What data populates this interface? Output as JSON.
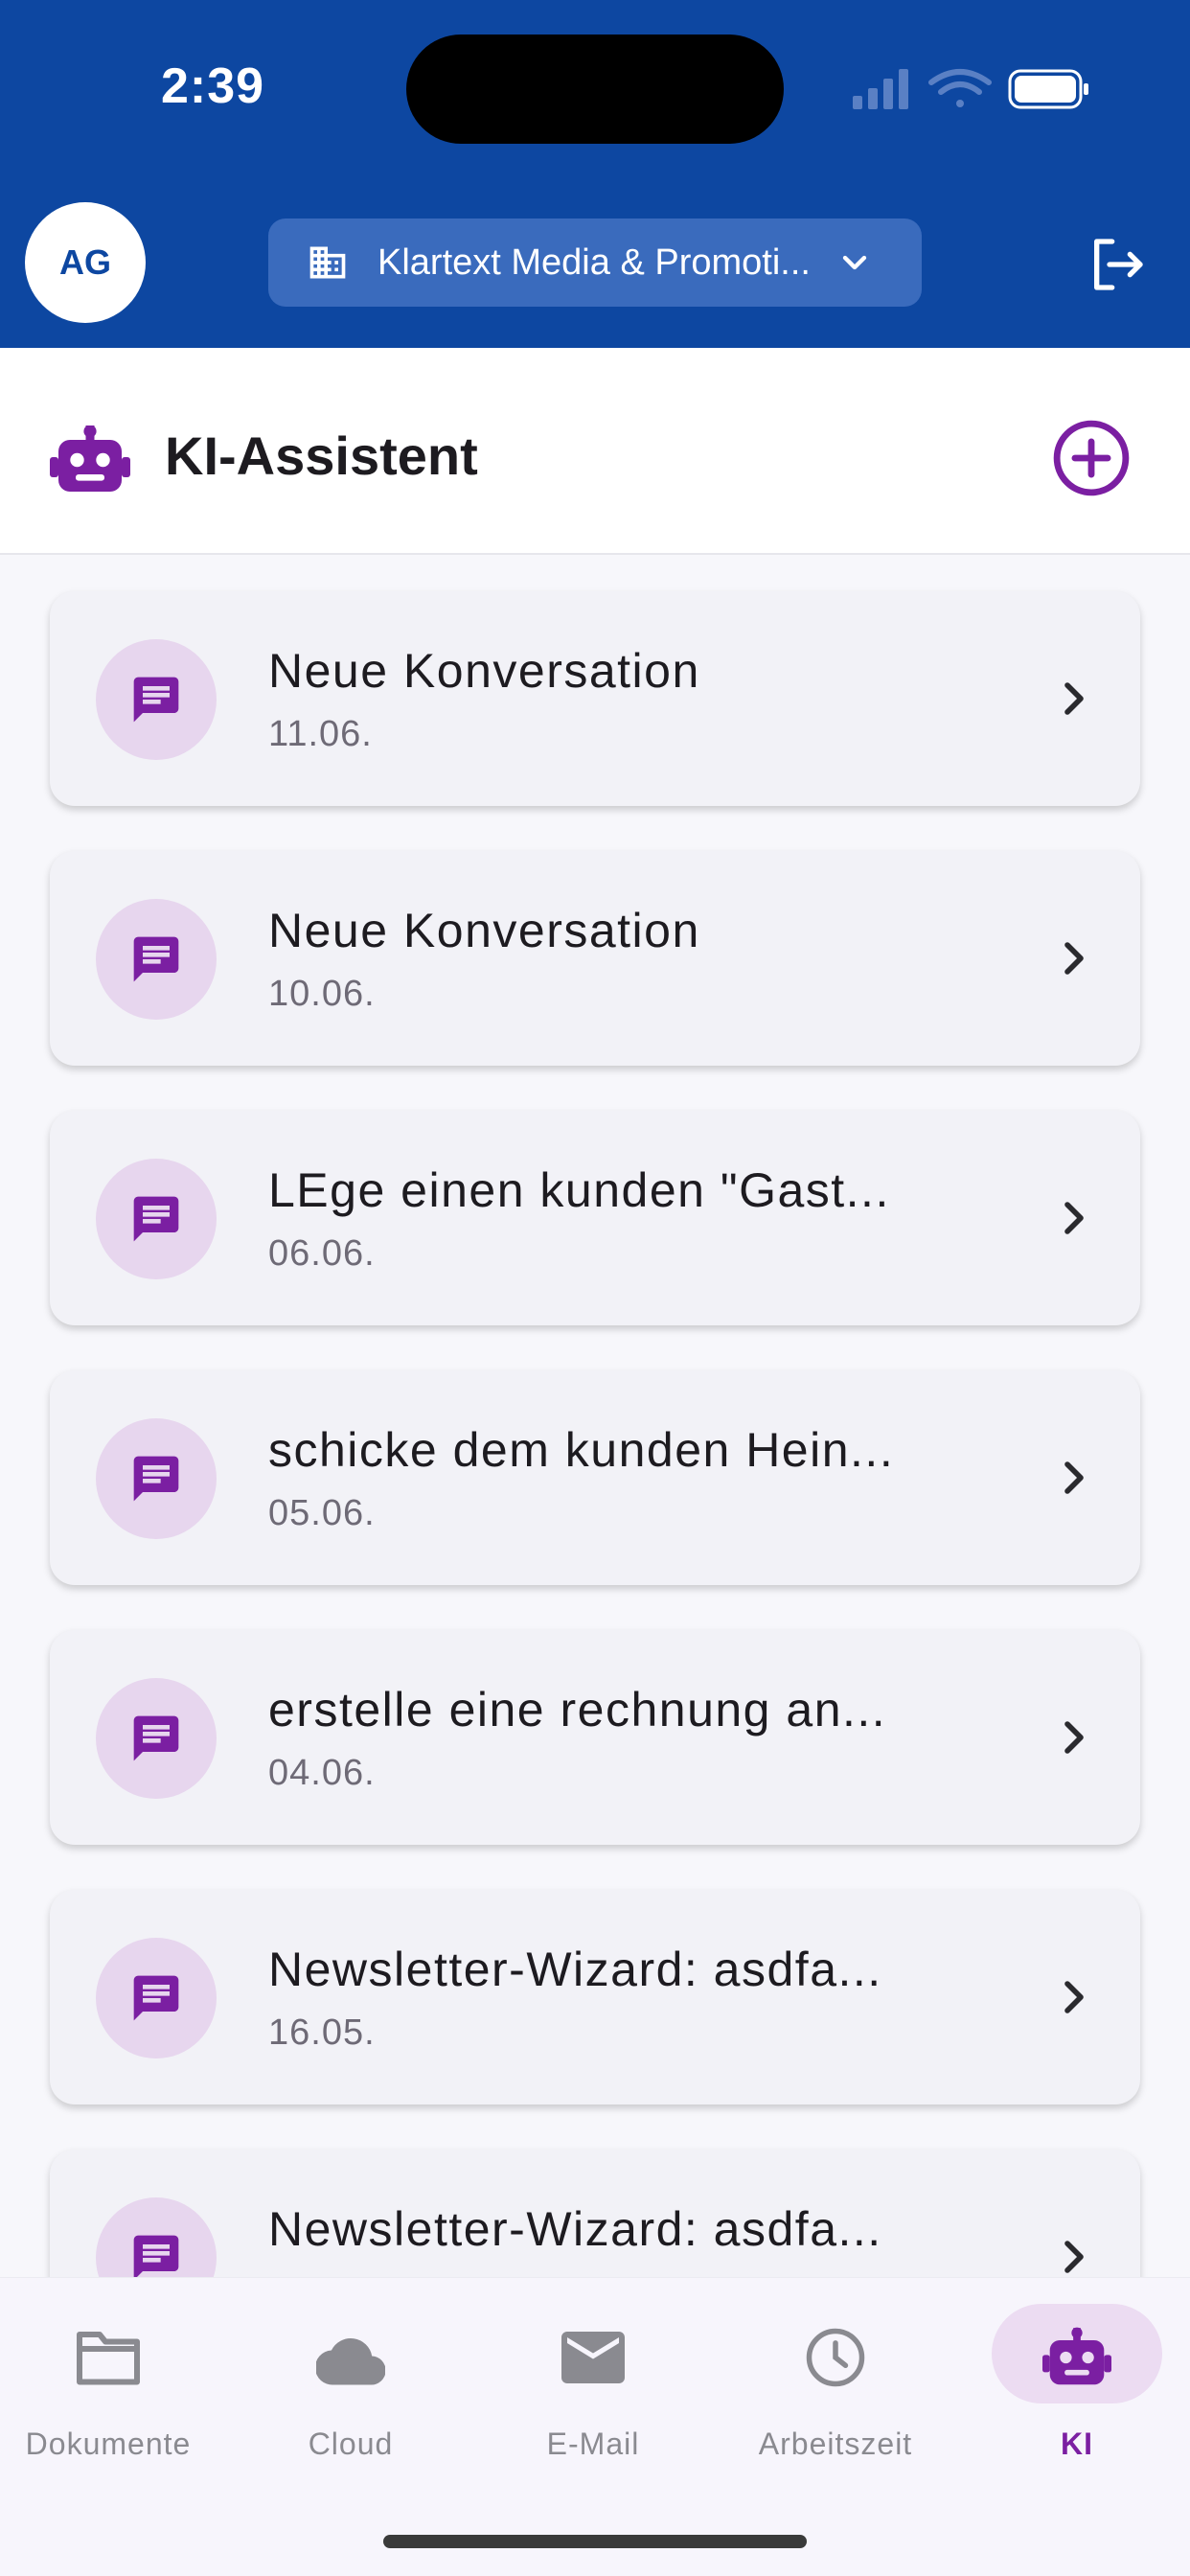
{
  "status": {
    "time": "2:39"
  },
  "header": {
    "avatar_initials": "AG",
    "company_name": "Klartext Media & Promoti..."
  },
  "titlebar": {
    "title": "KI-Assistent"
  },
  "conversations": [
    {
      "title": "Neue Konversation",
      "date": "11.06."
    },
    {
      "title": "Neue Konversation",
      "date": "10.06."
    },
    {
      "title": "LEge einen kunden \"Gast...",
      "date": "06.06."
    },
    {
      "title": "schicke dem kunden Hein...",
      "date": "05.06."
    },
    {
      "title": "erstelle eine rechnung an...",
      "date": "04.06."
    },
    {
      "title": "Newsletter-Wizard: asdfa...",
      "date": "16.05."
    },
    {
      "title": "Newsletter-Wizard: asdfa...",
      "date": ""
    }
  ],
  "nav": {
    "items": [
      {
        "label": "Dokumente",
        "icon": "folder-icon"
      },
      {
        "label": "Cloud",
        "icon": "cloud-icon"
      },
      {
        "label": "E-Mail",
        "icon": "mail-icon"
      },
      {
        "label": "Arbeitszeit",
        "icon": "clock-icon"
      },
      {
        "label": "KI",
        "icon": "robot-icon"
      }
    ],
    "active": "KI"
  },
  "colors": {
    "header_bg": "#0d47a1",
    "accent": "#7b1fa2",
    "icon_circle_bg": "#e7d6ee",
    "card_bg": "#f2f2f7"
  }
}
